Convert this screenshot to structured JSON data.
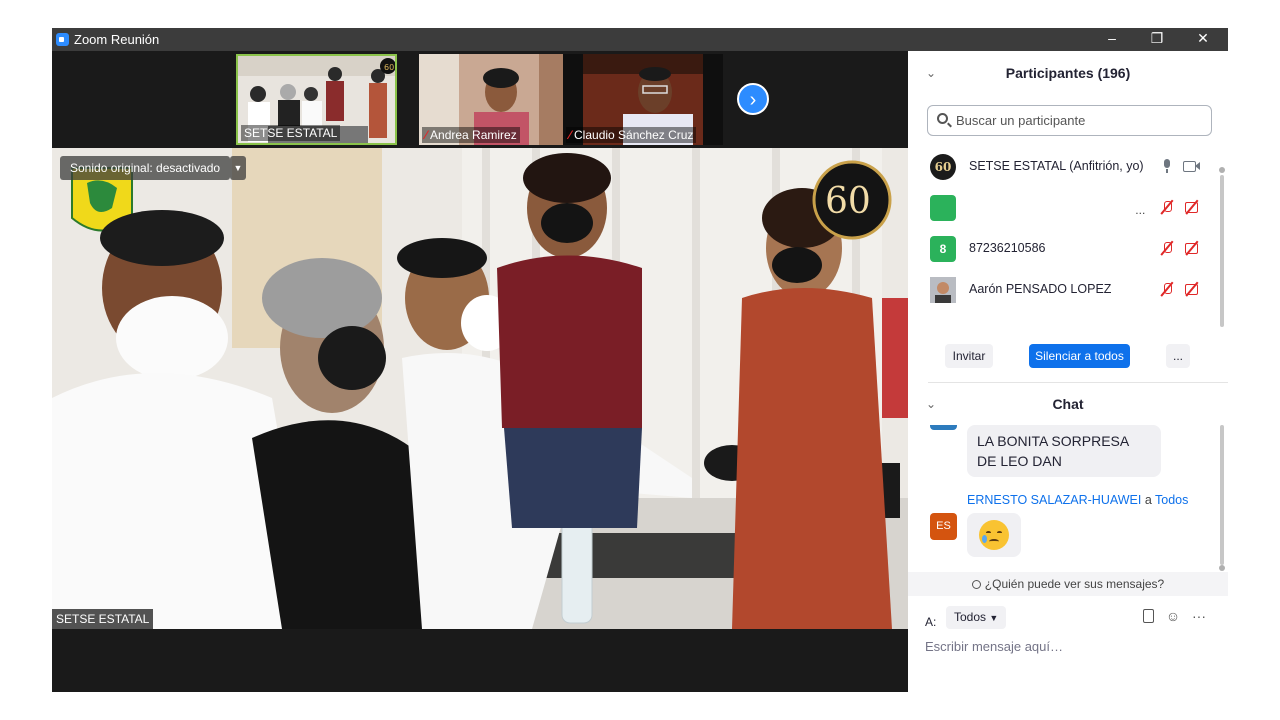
{
  "window": {
    "title": "Zoom Reunión",
    "controls": [
      "–",
      "❐",
      "✕"
    ]
  },
  "thumbnails": [
    {
      "name": "SETSE ESTATAL",
      "muted": false
    },
    {
      "name": "Andrea Ramirez",
      "muted": true
    },
    {
      "name": "Claudio Sánchez Cruz",
      "muted": true
    }
  ],
  "main_video": {
    "speaker_name": "SETSE ESTATAL",
    "sound_label": "Sonido original: desactivado",
    "badge_text": "60"
  },
  "participants": {
    "title": "Participantes (196)",
    "search_placeholder": "Buscar un participante",
    "items": [
      {
        "avatar_text": "60",
        "avatar_color": "#1b1b1b",
        "name": "SETSE ESTATAL (Anfitrión, yo)",
        "mic": "on",
        "cam": "on",
        "more": ""
      },
      {
        "avatar_text": "",
        "avatar_color": "#2bb25b",
        "name": "",
        "mic": "off",
        "cam": "off",
        "more": "..."
      },
      {
        "avatar_text": "8",
        "avatar_color": "#2bb25b",
        "name": "87236210586",
        "mic": "off",
        "cam": "off",
        "more": ""
      },
      {
        "avatar_text": "",
        "avatar_color": "#8a8f96",
        "name": "Aarón PENSADO LOPEZ",
        "mic": "off",
        "cam": "off",
        "more": ""
      }
    ],
    "buttons": {
      "invite": "Invitar",
      "mute_all": "Silenciar a todos",
      "more": "..."
    }
  },
  "chat": {
    "title": "Chat",
    "messages": [
      {
        "text": "LA BONITA SORPRESA DE LEO DAN"
      },
      {
        "sender": "ERNESTO SALAZAR-HUAWEI",
        "connector": "a",
        "recipient": "Todos",
        "avatar_text": "ES",
        "avatar_color": "#d4540f",
        "emoji": "crying-face"
      }
    ],
    "privacy_text": "¿Quién puede ver sus mensajes?",
    "to_label": "A:",
    "to_value": "Todos",
    "input_placeholder": "Escribir mensaje aquí…",
    "more": "···"
  },
  "colors": {
    "accent": "#0e71eb",
    "muted_red": "#e02828",
    "titlebar": "#3c3c3c"
  }
}
